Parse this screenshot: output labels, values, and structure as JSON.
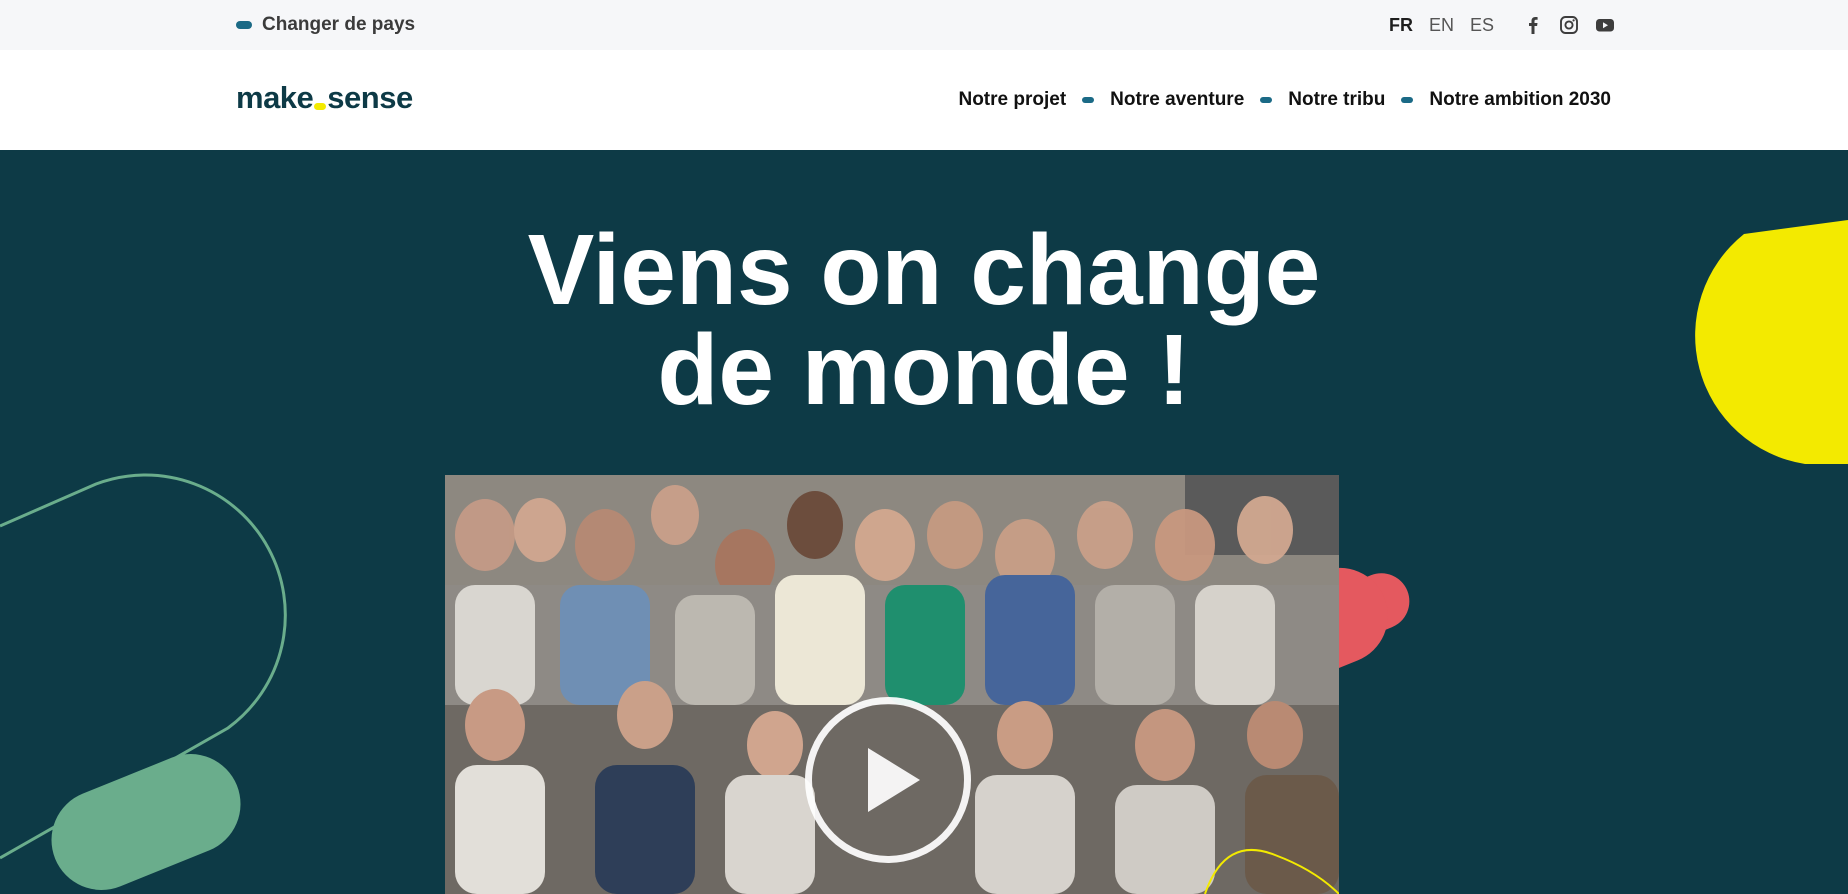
{
  "topbar": {
    "country_label": "Changer de pays",
    "languages": [
      {
        "code": "FR",
        "active": true
      },
      {
        "code": "EN",
        "active": false
      },
      {
        "code": "ES",
        "active": false
      }
    ],
    "socials": [
      "facebook-icon",
      "instagram-icon",
      "youtube-icon"
    ]
  },
  "nav": {
    "logo_part1": "make",
    "logo_part2": "sense",
    "items": [
      "Notre projet",
      "Notre aventure",
      "Notre tribu",
      "Notre ambition 2030"
    ]
  },
  "hero": {
    "title_line1": "Viens on change",
    "title_line2": "de monde !"
  },
  "colors": {
    "background": "#0d3a46",
    "accent_blue": "#1b6a86",
    "yellow": "#f3ea00",
    "green": "#6aad8c",
    "red": "#e4595f"
  }
}
